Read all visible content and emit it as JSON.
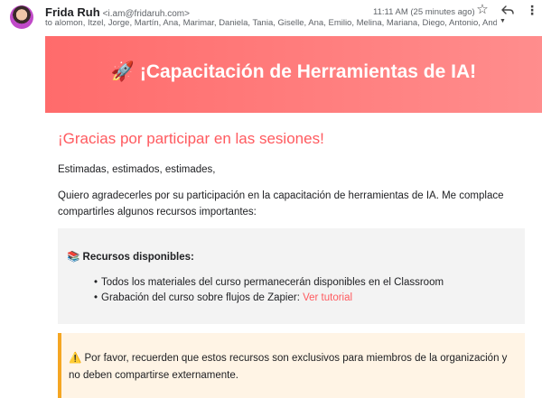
{
  "header": {
    "sender_name": "Frida Ruh",
    "sender_email": "<i.am@fridaruh.com>",
    "time": "11:11 AM (25 minutes ago)",
    "recipients": "to alomon, Itzel, Jorge, Martín, Ana, Marimar, Daniela, Tania, Giselle, Ana, Emilio, Melina, Mariana, Diego, Antonio, Andrea, Andrea, Y",
    "icons": {
      "star": "star-icon",
      "reply": "reply-icon",
      "more": "more-vert-icon",
      "expand": "chevron-down-icon"
    }
  },
  "banner": {
    "title": "🚀 ¡Capacitación de Herramientas de IA!"
  },
  "body": {
    "thanks": "¡Gracias por participar en las sesiones!",
    "greeting": "Estimadas, estimados, estimades,",
    "intro": "Quiero agradecerles por su participación en la capacitación de herramientas de IA. Me complace compartirles algunos recursos importantes:"
  },
  "resources": {
    "title": "📚 Recursos disponibles:",
    "items": [
      {
        "text": "Todos los materiales del curso permanecerán disponibles en el Classroom"
      },
      {
        "text": "Grabación del curso sobre flujos de Zapier: ",
        "link": "Ver tutorial"
      }
    ]
  },
  "warning": {
    "text": "⚠️ Por favor, recuerden que estos recursos son exclusivos para miembros de la organización y no deben compartirse externamente."
  },
  "colors": {
    "banner_start": "#ff6b6b",
    "banner_end": "#ff8d8d",
    "accent": "#ff5a5f",
    "warning_border": "#f5a623",
    "warning_bg": "#fff4e5"
  }
}
